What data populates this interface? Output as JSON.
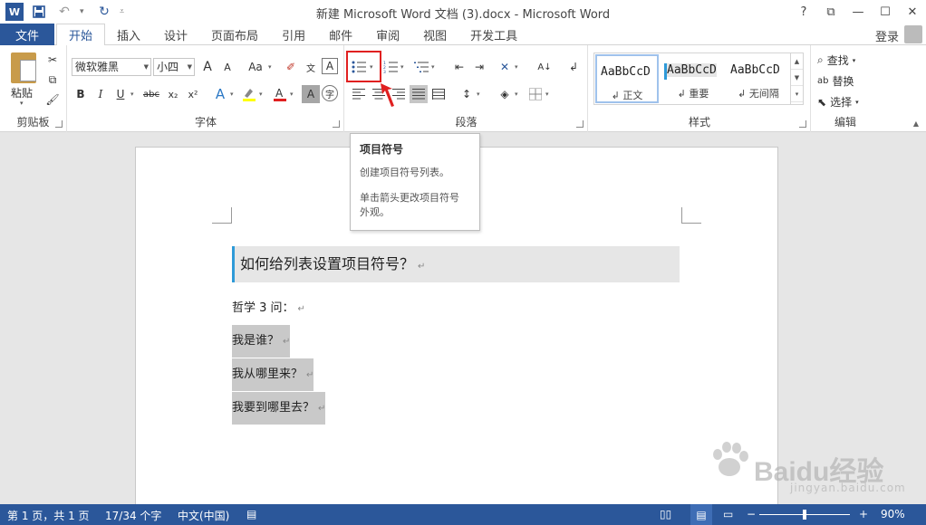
{
  "titlebar": {
    "title": "新建 Microsoft Word 文档 (3).docx - Microsoft Word",
    "logo": "W",
    "help": "?",
    "ribbon_display": "⧉",
    "minimize": "—",
    "maximize": "☐",
    "close": "✕"
  },
  "tabs": {
    "file": "文件",
    "items": [
      "开始",
      "插入",
      "设计",
      "页面布局",
      "引用",
      "邮件",
      "审阅",
      "视图",
      "开发工具"
    ],
    "login": "登录"
  },
  "ribbon": {
    "clipboard": {
      "label": "剪贴板",
      "paste": "粘贴"
    },
    "font": {
      "label": "字体",
      "font_name": "微软雅黑",
      "font_size": "小四",
      "bold": "B",
      "italic": "I",
      "underline": "U",
      "strike": "abc",
      "subscript": "x₂",
      "superscript": "x²",
      "grow": "A",
      "shrink": "A",
      "case": "Aa"
    },
    "paragraph": {
      "label": "段落"
    },
    "styles": {
      "label": "样式",
      "items": [
        {
          "sample": "AaBbCcD",
          "name": "↲ 正文"
        },
        {
          "sample": "AaBbCcD",
          "name": "↲ 重要"
        },
        {
          "sample": "AaBbCcD",
          "name": "↲ 无间隔"
        }
      ]
    },
    "editing": {
      "label": "编辑",
      "find": "查找",
      "replace": "替换",
      "select": "选择"
    }
  },
  "tooltip": {
    "title": "项目符号",
    "line1": "创建项目符号列表。",
    "line2": "单击箭头更改项目符号",
    "line3": "外观。"
  },
  "document": {
    "heading": "如何给列表设置项目符号？",
    "para_intro": "哲学 3 问：",
    "items": [
      "我是谁？",
      "我从哪里来？",
      "我要到哪里去？"
    ],
    "pilcrow": "↵"
  },
  "statusbar": {
    "page": "第 1 页，共 1 页",
    "words": "17/34 个字",
    "language": "中文(中国)",
    "zoom": "90%",
    "zoom_level": 0.5
  },
  "watermark": {
    "text": "Baidu经验",
    "sub": "jingyan.baidu.com"
  },
  "colors": {
    "accent": "#2b579a",
    "highlight_box": "#e02020"
  }
}
